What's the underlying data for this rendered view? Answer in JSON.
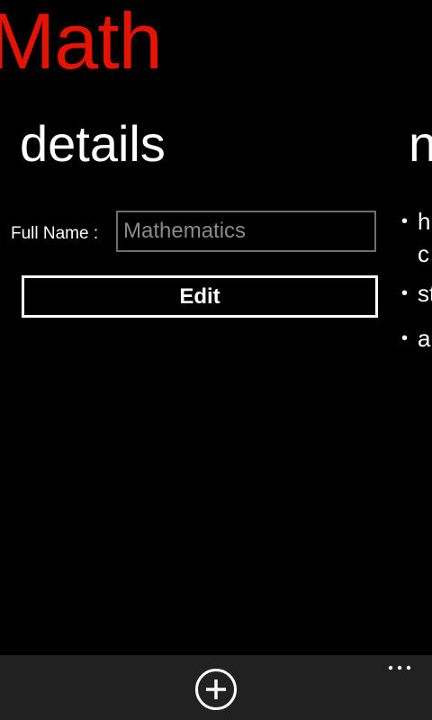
{
  "app": {
    "title": "Math",
    "accent_color": "#e51400"
  },
  "pivot": {
    "current_title": "details",
    "next_title": "n"
  },
  "details": {
    "full_name_label": "Full Name :",
    "full_name_value": "Mathematics",
    "edit_label": "Edit"
  },
  "next_panel": {
    "items": [
      {
        "line1": "h",
        "line2": "c"
      },
      {
        "line1": "st"
      },
      {
        "line1": "a"
      }
    ]
  },
  "app_bar": {
    "add_icon": "add-circle-icon",
    "more_label": "..."
  }
}
